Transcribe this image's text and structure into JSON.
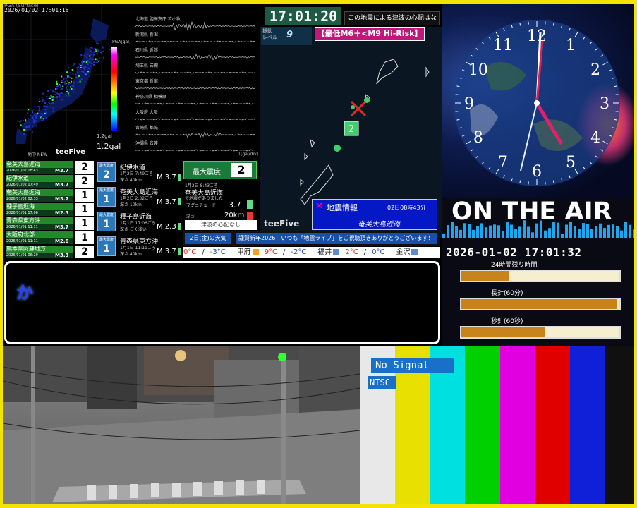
{
  "pga_panel": {
    "header": "PGA (Surface)",
    "timestamp": "2026/01/02 17:01:18",
    "scale_label": "PGA[gal]",
    "gal_value": "1.2gal",
    "gal_small": "1.2gal",
    "brand": "teeFive",
    "brand_note": "地中 NEW"
  },
  "waveforms": {
    "stations": [
      "北海道 胆振支庁 苫小牧",
      "新潟県 新潟",
      "石川県 近郊",
      "埼玉県 岩槻",
      "東京都 新宿",
      "神奈川県 相模原",
      "大阪府 大阪",
      "宮崎県 都城",
      "沖縄県 名護"
    ],
    "scale": "1[gal/div]"
  },
  "top_clock": "17:01:20",
  "tsunami_info": "この地震による津波の心配はなし",
  "quake_map": {
    "level_label": "振動\nレベル",
    "level_value": "9",
    "risk": "【最低M6＋<M9 Hi-Risk】",
    "epicenter_intensity": "2",
    "info_title": "地震情報",
    "info_time": "02日08時43分",
    "info_region": "奄美大島近海",
    "brand": "teeFive"
  },
  "history": [
    {
      "name": "奄美大島近海",
      "date": "2026/01/02 08:43",
      "mag": "M3.7",
      "int": "2"
    },
    {
      "name": "紀伊水道",
      "date": "2026/01/02 07:49",
      "mag": "M3.7",
      "int": "2"
    },
    {
      "name": "奄美大島近海",
      "date": "2026/01/02 02:33",
      "mag": "M3.7",
      "int": "1"
    },
    {
      "name": "種子島近海",
      "date": "2026/01/01 17:06",
      "mag": "M2.3",
      "int": "1"
    },
    {
      "name": "青森県東方沖",
      "date": "2026/01/01 11:11",
      "mag": "M3.7",
      "int": "1"
    },
    {
      "name": "大阪府北部",
      "date": "2026/01/01 11:11",
      "mag": "M2.6",
      "int": "1"
    },
    {
      "name": "熊本県阿蘇地方",
      "date": "2026/01/01 06:29",
      "mag": "M3.3",
      "int": "2"
    }
  ],
  "cards": [
    {
      "badge": "最大震度",
      "int": "2",
      "name": "紀伊水道",
      "date": "1月2日 7:49ごろ",
      "depth": "深さ 40km",
      "mag": "M 3.7"
    },
    {
      "badge": "最大震度",
      "int": "1",
      "name": "奄美大島近海",
      "date": "1月2日 2:32ごろ",
      "depth": "深さ 10km",
      "mag": "M 3.7"
    },
    {
      "badge": "最大震度",
      "int": "1",
      "name": "種子島近海",
      "date": "1月1日 17:06ごろ",
      "depth": "深さ ごく浅い",
      "mag": "M 2.3"
    },
    {
      "badge": "最大震度",
      "int": "1",
      "name": "青森県東方沖",
      "date": "1月1日 11:11ごろ",
      "depth": "深さ 40km",
      "mag": "M 3.7"
    }
  ],
  "detail": {
    "max_label": "最大震度",
    "max_value": "2",
    "time": "1月2日 8:43ごろ",
    "region": "奄美大島近海",
    "note": "で地震がありました",
    "mag_label": "マグニチュード",
    "mag_value": "3.7",
    "depth_label": "深さ",
    "depth_value": "20km",
    "tsunami": "津波の心配なし"
  },
  "weather": {
    "day": "2日(金)の天気",
    "message": "謹賀新年2026　いつも「地震ライブ」をご視聴頂きありがとうございます！",
    "row": [
      {
        "city": "",
        "hi": "0°C",
        "lo": "-3°C"
      },
      {
        "city": "甲府",
        "hi": "9°C",
        "lo": "-2°C"
      },
      {
        "city": "福井",
        "hi": "2°C",
        "lo": "0°C"
      },
      {
        "city": "金沢",
        "hi": "",
        "lo": ""
      }
    ]
  },
  "text_box": "か",
  "clock_numbers": [
    "12",
    "1",
    "2",
    "3",
    "4",
    "5",
    "6",
    "7",
    "8",
    "9",
    "10",
    "11"
  ],
  "on_air": {
    "title": "ON THE AIR",
    "datetime": "2026-01-02 17:01:32",
    "bars": [
      {
        "label": "24時間残り時間",
        "fraction": 0.3
      },
      {
        "label": "長針(60分)",
        "fraction": 0.98
      },
      {
        "label": "秒針(60秒)",
        "fraction": 0.53
      }
    ]
  },
  "test_pattern": {
    "no_signal": "No Signal",
    "ntsc": "NTSC",
    "colors": [
      "#e8e8e8",
      "#e8e000",
      "#00e0e0",
      "#00d000",
      "#e000e0",
      "#e00000",
      "#1020d8",
      "#101010"
    ]
  },
  "colors": {
    "frame": "#f3e400",
    "accent_green": "#238a2b",
    "info_blue": "#0418c6",
    "risk_pink": "#c0177a"
  }
}
